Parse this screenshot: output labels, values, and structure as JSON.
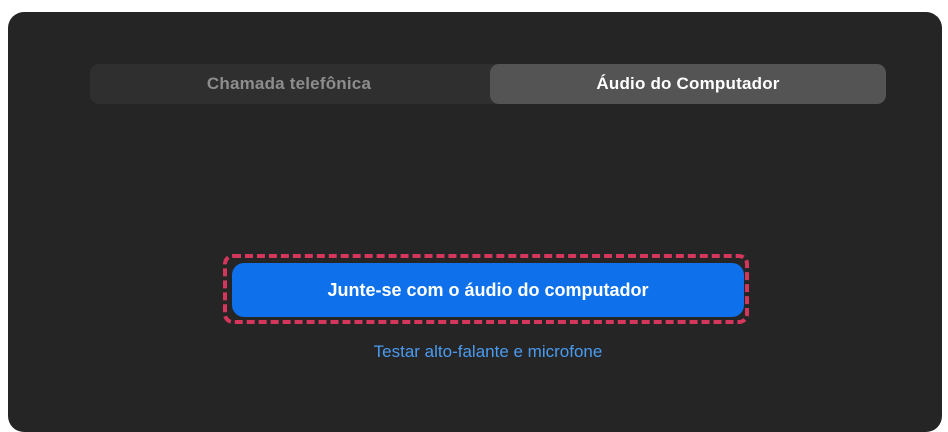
{
  "tabs": {
    "phone_call": "Chamada telefônica",
    "computer_audio": "Áudio do Computador",
    "selected": "computer_audio"
  },
  "join_button": {
    "label": "Junte-se com o áudio do computador"
  },
  "test_link": {
    "label": "Testar alto-falante e microfone"
  },
  "colors": {
    "dialog_bg": "#252525",
    "segment_bg": "#2f2f2f",
    "segment_selected_bg": "#545454",
    "primary_button": "#0e71eb",
    "link": "#4a9bf0",
    "highlight_ring": "#d4365c"
  }
}
